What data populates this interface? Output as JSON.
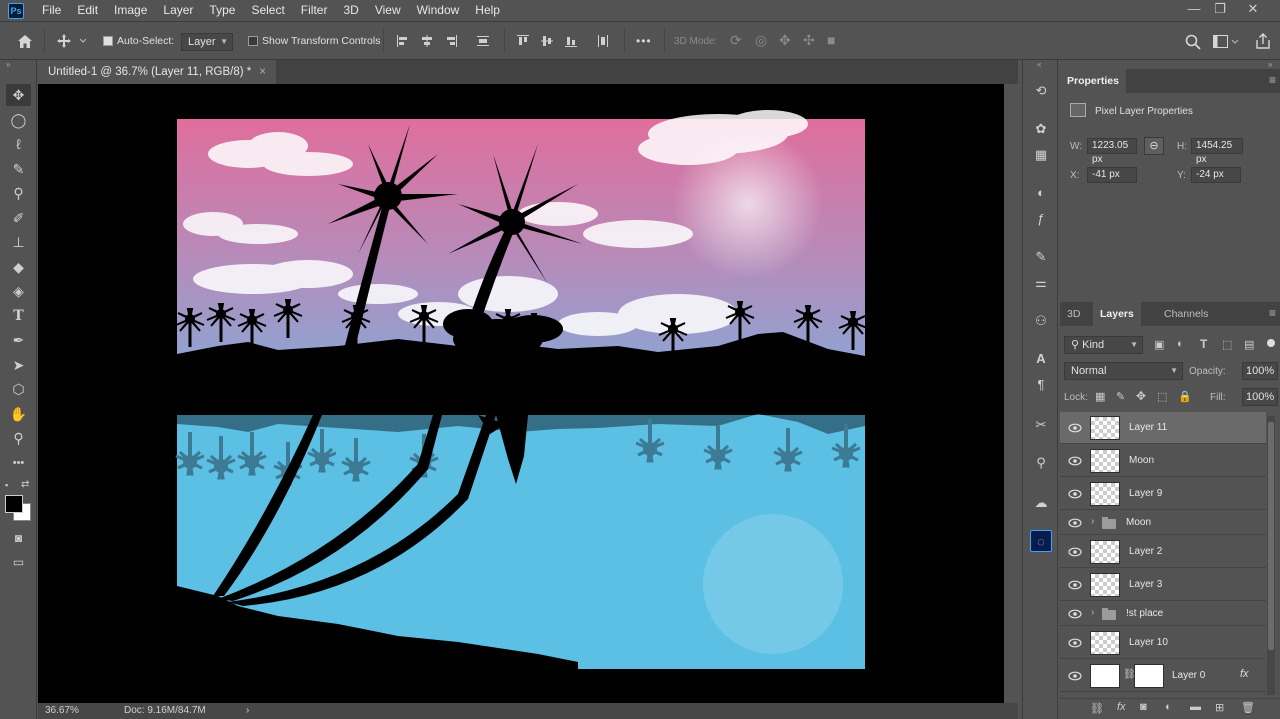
{
  "app": {
    "logo_text": "Ps"
  },
  "menu": [
    "File",
    "Edit",
    "Image",
    "Layer",
    "Type",
    "Select",
    "Filter",
    "3D",
    "View",
    "Window",
    "Help"
  ],
  "options": {
    "auto_select_label": "Auto-Select:",
    "auto_select_value": "Layer",
    "show_transform_label": "Show Transform Controls",
    "mode_3d_label": "3D Mode:",
    "more": "•••"
  },
  "document_tab": {
    "title": "Untitled-1 @ 36.7% (Layer 11, RGB/8) *",
    "close": "×"
  },
  "status": {
    "zoom": "36.67%",
    "doc": "Doc: 9.16M/84.7M",
    "arrow": "›"
  },
  "properties": {
    "tab": "Properties",
    "type": "Pixel Layer Properties",
    "w_label": "W:",
    "w": "1223.05 px",
    "h_label": "H:",
    "h": "1454.25 px",
    "x_label": "X:",
    "x": "-41 px",
    "y_label": "Y:",
    "y": "-24 px"
  },
  "layers_panel": {
    "tabs": [
      "3D",
      "Layers",
      "Channels"
    ],
    "active_tab": "Layers",
    "filter": "Kind",
    "blend_mode": "Normal",
    "opacity_label": "Opacity:",
    "opacity": "100%",
    "lock_label": "Lock:",
    "fill_label": "Fill:",
    "fill": "100%",
    "layers": [
      {
        "name": "Layer 11",
        "kind": "pixel",
        "selected": true
      },
      {
        "name": "Moon",
        "kind": "pixel",
        "selected": false
      },
      {
        "name": "Layer 9",
        "kind": "pixel",
        "selected": false
      },
      {
        "name": "Moon",
        "kind": "group",
        "selected": false
      },
      {
        "name": "Layer 2",
        "kind": "pixel",
        "selected": false
      },
      {
        "name": "Layer 3",
        "kind": "pixel",
        "selected": false
      },
      {
        "name": "!st place",
        "kind": "group",
        "selected": false
      },
      {
        "name": "Layer 10",
        "kind": "pixel",
        "selected": false
      },
      {
        "name": "Layer 0",
        "kind": "pixel-mask",
        "selected": false
      }
    ],
    "fx": "fx"
  },
  "colors": {
    "sky_top": "#e06e9d",
    "sky_bottom": "#8fa3d2",
    "water": "#5cc0e4",
    "accent": "#31a8ff"
  }
}
